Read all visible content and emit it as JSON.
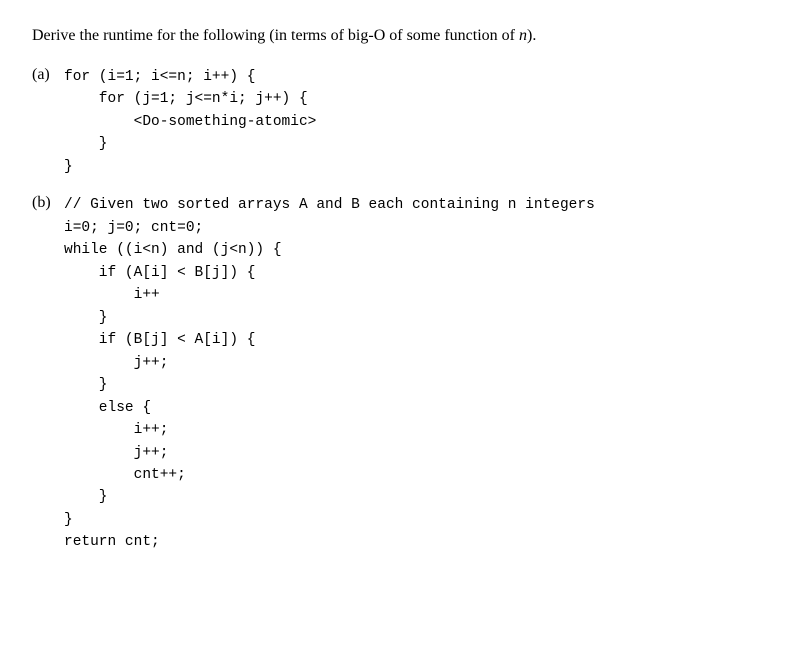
{
  "intro": {
    "text": "Derive the runtime for the following (in terms of big-O of some function of ",
    "variable": "n",
    "text_end": ")."
  },
  "sections": [
    {
      "label": "(a)",
      "code": "for (i=1; i<=n; i++) {\n    for (j=1; j<=n*i; j++) {\n        <Do-something-atomic>\n    }\n}"
    },
    {
      "label": "(b)",
      "code": "// Given two sorted arrays A and B each containing n integers\ni=0; j=0; cnt=0;\nwhile ((i<n) and (j<n)) {\n    if (A[i] < B[j]) {\n        i++\n    }\n    if (B[j] < A[i]) {\n        j++;\n    }\n    else {\n        i++;\n        j++;\n        cnt++;\n    }\n}\nreturn cnt;"
    }
  ]
}
